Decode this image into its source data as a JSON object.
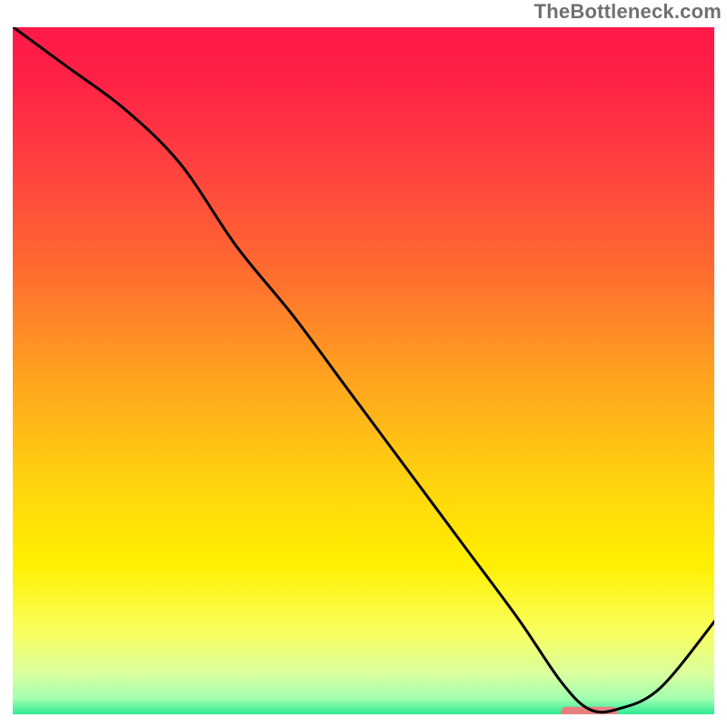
{
  "watermark": "TheBottleneck.com",
  "chart_data": {
    "type": "line",
    "title": "",
    "xlabel": "",
    "ylabel": "",
    "xlim": [
      0,
      100
    ],
    "ylim": [
      0,
      100
    ],
    "series": [
      {
        "name": "curve",
        "x": [
          0,
          8,
          16,
          24,
          32,
          40,
          48,
          56,
          64,
          72,
          78,
          82,
          86,
          92,
          100
        ],
        "values": [
          100,
          94,
          88,
          80,
          68,
          58,
          47,
          36,
          25,
          14,
          5,
          1,
          1,
          4,
          14
        ]
      }
    ],
    "gradient_stops": [
      {
        "offset": 0.0,
        "color": "#ff1848"
      },
      {
        "offset": 0.08,
        "color": "#ff2246"
      },
      {
        "offset": 0.2,
        "color": "#ff4040"
      },
      {
        "offset": 0.35,
        "color": "#ff6a30"
      },
      {
        "offset": 0.5,
        "color": "#ffa020"
      },
      {
        "offset": 0.65,
        "color": "#ffd010"
      },
      {
        "offset": 0.78,
        "color": "#fff000"
      },
      {
        "offset": 0.88,
        "color": "#f8ff60"
      },
      {
        "offset": 0.94,
        "color": "#d8ffa0"
      },
      {
        "offset": 0.975,
        "color": "#a0ffb0"
      },
      {
        "offset": 1.0,
        "color": "#20e890"
      }
    ],
    "marker": {
      "x_center": 82,
      "y": 0.5,
      "width": 8,
      "color": "#e88080"
    },
    "plot_border_color": "#ffffff",
    "curve_color": "#000000",
    "curve_width": 3
  }
}
